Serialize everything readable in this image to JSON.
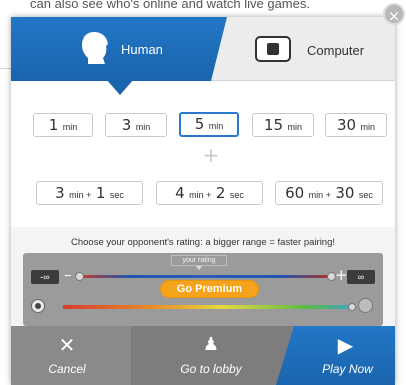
{
  "background": {
    "partial_text": "can also see who's online and watch live games."
  },
  "close_icon": "×",
  "tabs": {
    "human_label": "Human",
    "computer_label": "Computer"
  },
  "time_controls": {
    "row1": [
      {
        "big": "1",
        "small": "min"
      },
      {
        "big": "3",
        "small": "min"
      },
      {
        "big": "5",
        "small": "min",
        "selected": true
      },
      {
        "big": "15",
        "small": "min"
      },
      {
        "big": "30",
        "small": "min"
      }
    ],
    "divider_icon": "+",
    "row2": [
      {
        "big1": "3",
        "small1": "min +",
        "big2": "1",
        "small2": "sec"
      },
      {
        "big1": "4",
        "small1": "min +",
        "big2": "2",
        "small2": "sec"
      },
      {
        "big1": "60",
        "small1": "min +",
        "big2": "30",
        "small2": "sec"
      }
    ]
  },
  "rating": {
    "hint": "Choose your opponent's rating: a bigger range = faster pairing!",
    "min_label": "-∞",
    "max_label": "∞",
    "minus_icon": "−",
    "plus_icon": "+",
    "your_rating_label": "your rating",
    "premium_button": "Go Premium"
  },
  "footer": {
    "cancel_icon": "✕",
    "cancel_label": "Cancel",
    "lobby_icon": "♟",
    "lobby_label": "Go to lobby",
    "play_icon": "▶",
    "play_label": "Play Now"
  },
  "colors": {
    "accent": "#1a64ad",
    "selected_border": "#2a7bd0",
    "premium": "#f5a31a",
    "footer": "#7f7f7f"
  }
}
